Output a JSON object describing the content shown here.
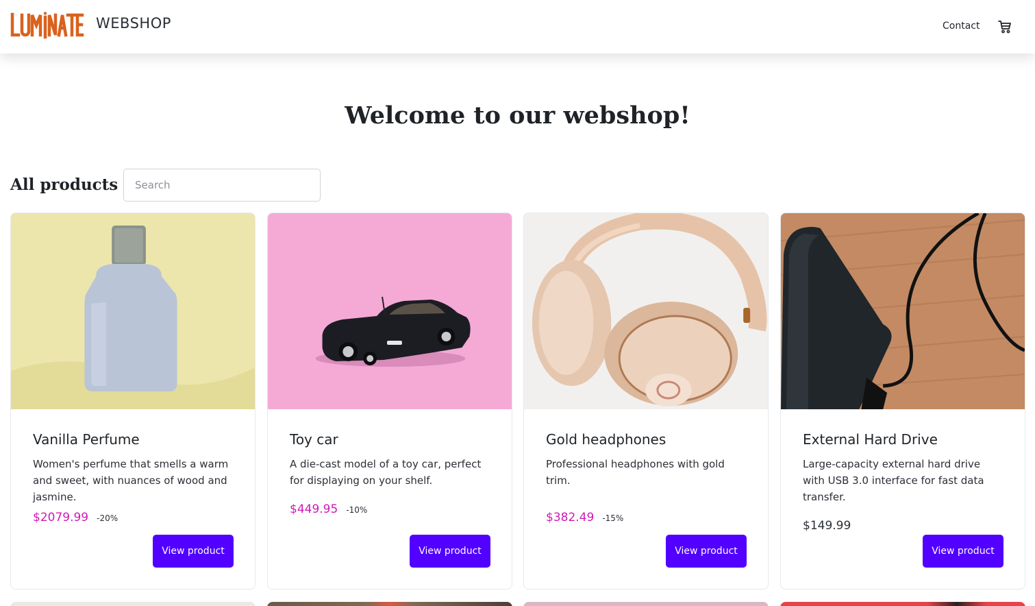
{
  "header": {
    "logo_text": "LUMINATE",
    "brand_subtitle": "WEBSHOP",
    "nav_contact": "Contact",
    "cart_icon": "cart-icon"
  },
  "colors": {
    "brand_orange": "#d9621e",
    "accent_purple": "#5200ff",
    "sale_price": "#d019b8"
  },
  "hero": {
    "title": "Welcome to our webshop!"
  },
  "products_section": {
    "title": "All products",
    "search_placeholder": "Search"
  },
  "products": [
    {
      "name": "Vanilla Perfume",
      "description": "Women's perfume that smells a warm and sweet, with nuances of wood and jasmine.",
      "price": "$2079.99",
      "discount": "-20%",
      "on_sale": true,
      "button": "View product"
    },
    {
      "name": "Toy car",
      "description": "A die-cast model of a toy car, perfect for displaying on your shelf.",
      "price": "$449.95",
      "discount": "-10%",
      "on_sale": true,
      "button": "View product"
    },
    {
      "name": "Gold headphones",
      "description": "Professional headphones with gold trim.",
      "price": "$382.49",
      "discount": "-15%",
      "on_sale": true,
      "button": "View product"
    },
    {
      "name": "External Hard Drive",
      "description": "Large-capacity external hard drive with USB 3.0 interface for fast data transfer.",
      "price": "$149.99",
      "discount": "",
      "on_sale": false,
      "button": "View product"
    }
  ]
}
